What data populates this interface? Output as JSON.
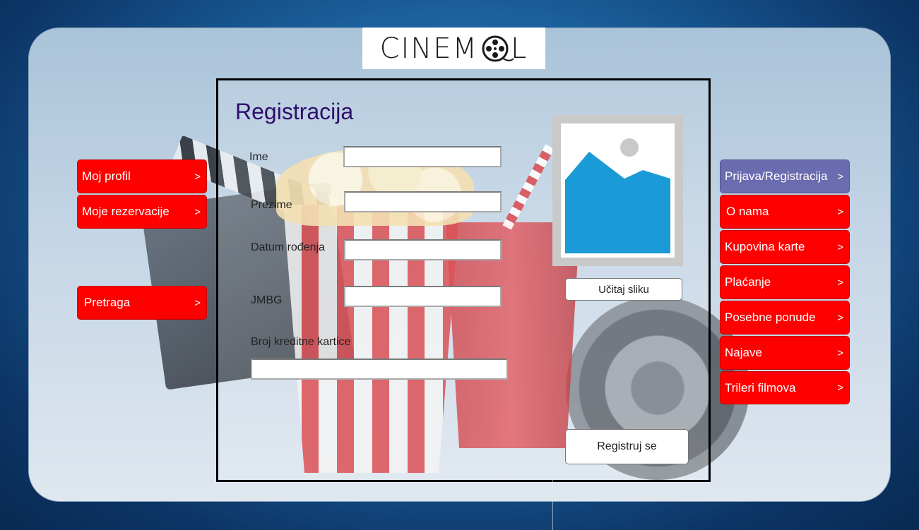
{
  "logo": {
    "text": "CINEM",
    "tail": "L",
    "icon": "film-reel-icon"
  },
  "form": {
    "title": "Registracija",
    "fields": [
      {
        "label": "Ime",
        "value": "",
        "placeholder": ""
      },
      {
        "label": "Prezime",
        "value": "",
        "placeholder": ""
      },
      {
        "label": "Datum rođenja",
        "value": "",
        "placeholder": ""
      },
      {
        "label": "JMBG",
        "value": "",
        "placeholder": ""
      },
      {
        "label": "Broj kreditne kartice",
        "value": "",
        "placeholder": ""
      }
    ],
    "photo_icon": "image-placeholder-icon",
    "upload_button": "Učitaj sliku",
    "submit_button": "Registruj se"
  },
  "left_nav": [
    {
      "label": "Moj profil",
      "arrow": ">"
    },
    {
      "label": "Moje rezervacije",
      "arrow": ">"
    },
    {
      "label": "Pretraga",
      "arrow": ">"
    }
  ],
  "right_nav": [
    {
      "label": "Prijava/Registracija",
      "arrow": ">",
      "active": true
    },
    {
      "label": "O nama",
      "arrow": ">"
    },
    {
      "label": "Kupovina karte",
      "arrow": ">"
    },
    {
      "label": "Plaćanje",
      "arrow": ">"
    },
    {
      "label": "Posebne ponude",
      "arrow": ">"
    },
    {
      "label": "Najave",
      "arrow": ">"
    },
    {
      "label": "Trileri filmova",
      "arrow": ">"
    }
  ],
  "colors": {
    "nav_red": "#ff0000",
    "nav_active": "#6b6bb0",
    "title": "#2e0d6b",
    "photo_blue": "#1a9ad6"
  }
}
